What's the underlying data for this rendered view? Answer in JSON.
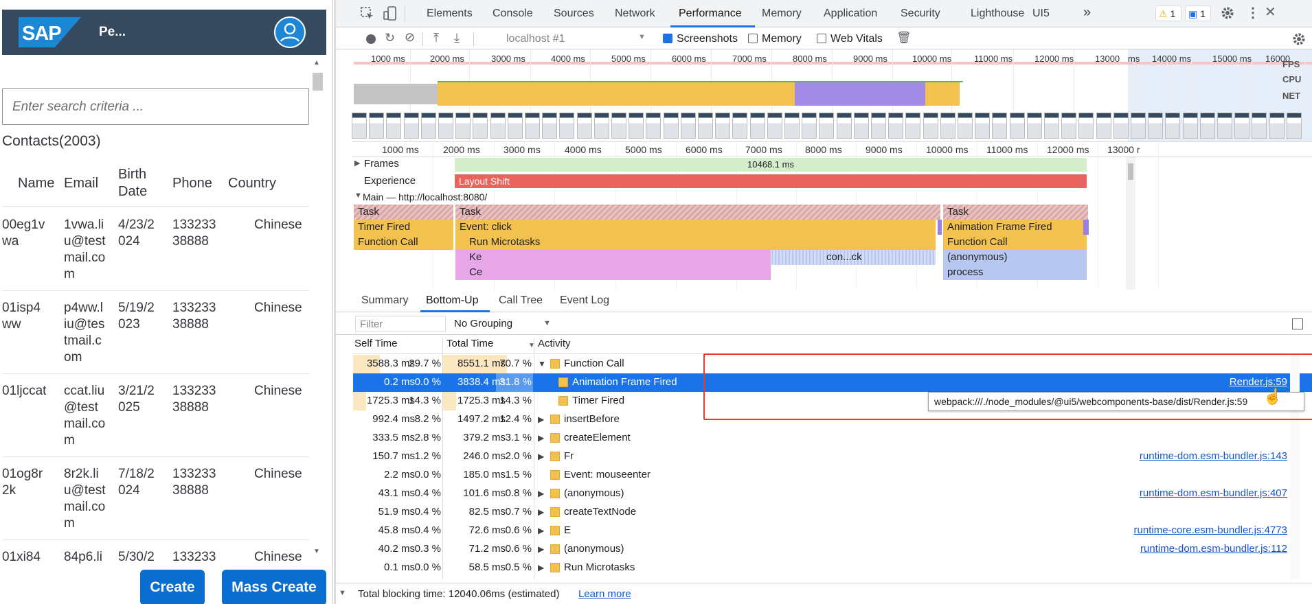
{
  "app": {
    "logo": "SAP",
    "title": "Pe...",
    "search_placeholder": "Enter search criteria ...",
    "section_title": "Contacts(2003)",
    "columns": [
      "Name",
      "Email",
      "Birth Date",
      "Phone",
      "Country"
    ],
    "rows": [
      {
        "name": "00eg1v wa",
        "email": "1vwa.li u@test mail.co m",
        "birth": "4/23/2 024",
        "phone": "133233 38888",
        "country": "Chinese"
      },
      {
        "name": "01isp4 ww",
        "email": "p4ww.l iu@tes tmail.c om",
        "birth": "5/19/2 023",
        "phone": "133233 38888",
        "country": "Chinese"
      },
      {
        "name": "01ljccat",
        "email": "ccat.liu @test mail.co m",
        "birth": "3/21/2 025",
        "phone": "133233 38888",
        "country": "Chinese"
      },
      {
        "name": "01og8r 2k",
        "email": "8r2k.li u@test mail.co m",
        "birth": "7/18/2 024",
        "phone": "133233 38888",
        "country": "Chinese"
      },
      {
        "name": "01xi84",
        "email": "84p6.li",
        "birth": "5/30/2",
        "phone": "133233",
        "country": "Chinese"
      }
    ],
    "create_label": "Create",
    "mass_create_label": "Mass Create"
  },
  "devtools": {
    "tabs": [
      "Elements",
      "Console",
      "Sources",
      "Network",
      "Performance",
      "Memory",
      "Application",
      "Security",
      "Lighthouse",
      "UI5"
    ],
    "more": "»",
    "active_tab": "Performance",
    "warnings": "1",
    "messages": "1",
    "target": "localhost #1",
    "screenshots_label": "Screenshots",
    "memory_label": "Memory",
    "webvitals_label": "Web Vitals",
    "screenshots_checked": true,
    "memory_checked": false,
    "webvitals_checked": false,
    "overview_ticks": [
      "1000 ms",
      "2000 ms",
      "3000 ms",
      "4000 ms",
      "5000 ms",
      "6000 ms",
      "7000 ms",
      "8000 ms",
      "9000 ms",
      "10000 ms",
      "11000 ms",
      "12000 ms",
      "13000",
      "ms",
      "14000 ms",
      "15000 ms",
      "16000"
    ],
    "overview_labels": [
      "FPS",
      "CPU",
      "NET"
    ],
    "timeline_ticks": [
      "1000 ms",
      "2000 ms",
      "3000 ms",
      "4000 ms",
      "5000 ms",
      "6000 ms",
      "7000 ms",
      "8000 ms",
      "9000 ms",
      "10000 ms",
      "11000 ms",
      "12000 ms",
      "13000 r"
    ],
    "frames_label": "Frames",
    "frames_value": "10468.1 ms",
    "experience_label": "Experience",
    "layout_shift": "Layout Shift",
    "main_label": "Main — http://localhost:8080/",
    "flame": {
      "task": "Task",
      "timer_fired": "Timer Fired",
      "event_click": "Event: click",
      "function_call": "Function Call",
      "run_microtasks": "Run Microtasks",
      "ke": "Ke",
      "ce": "Ce",
      "conck": "con...ck",
      "animation_frame_fired": "Animation Frame Fired",
      "anonymous": "(anonymous)",
      "process": "process"
    },
    "bottom_tabs": [
      "Summary",
      "Bottom-Up",
      "Call Tree",
      "Event Log"
    ],
    "active_bottom_tab": "Bottom-Up",
    "filter_placeholder": "Filter",
    "grouping": "No Grouping",
    "headers": {
      "self": "Self Time",
      "total": "Total Time",
      "activity": "Activity"
    },
    "rows": [
      {
        "self": "3588.3 ms",
        "self_pct": "29.7 %",
        "total": "8551.1 ms",
        "total_pct": "70.7 %",
        "activity": "Function Call",
        "expanded": true,
        "indent": 0,
        "link": "",
        "self_fill": 29.7,
        "total_fill": 70.7
      },
      {
        "self": "0.2 ms",
        "self_pct": "0.0 %",
        "total": "3838.4 ms",
        "total_pct": "31.8 %",
        "activity": "Animation Frame Fired",
        "expanded": false,
        "indent": 1,
        "link": "Render.js:59",
        "self_fill": 0,
        "total_fill": 31.8,
        "selected": true
      },
      {
        "self": "1725.3 ms",
        "self_pct": "14.3 %",
        "total": "1725.3 ms",
        "total_pct": "14.3 %",
        "activity": "Timer Fired",
        "expanded": false,
        "indent": 1,
        "link": "",
        "self_fill": 14.3,
        "total_fill": 14.3
      },
      {
        "self": "992.4 ms",
        "self_pct": "8.2 %",
        "total": "1497.2 ms",
        "total_pct": "12.4 %",
        "activity": "insertBefore",
        "expanded": false,
        "indent": 0,
        "link": "",
        "self_fill": 8.2,
        "total_fill": 12.4
      },
      {
        "self": "333.5 ms",
        "self_pct": "2.8 %",
        "total": "379.2 ms",
        "total_pct": "3.1 %",
        "activity": "createElement",
        "expanded": false,
        "indent": 0,
        "link": "",
        "self_fill": 2.8,
        "total_fill": 3.1
      },
      {
        "self": "150.7 ms",
        "self_pct": "1.2 %",
        "total": "246.0 ms",
        "total_pct": "2.0 %",
        "activity": "Fr",
        "expanded": false,
        "indent": 0,
        "link": "runtime-dom.esm-bundler.js:143",
        "self_fill": 1.2,
        "total_fill": 2.0
      },
      {
        "self": "2.2 ms",
        "self_pct": "0.0 %",
        "total": "185.0 ms",
        "total_pct": "1.5 %",
        "activity": "Event: mouseenter",
        "expanded": false,
        "indent": 0,
        "link": "",
        "self_fill": 0,
        "total_fill": 1.5,
        "noarrow": true
      },
      {
        "self": "43.1 ms",
        "self_pct": "0.4 %",
        "total": "101.6 ms",
        "total_pct": "0.8 %",
        "activity": "(anonymous)",
        "expanded": false,
        "indent": 0,
        "link": "runtime-dom.esm-bundler.js:407",
        "self_fill": 0.4,
        "total_fill": 0.8
      },
      {
        "self": "51.9 ms",
        "self_pct": "0.4 %",
        "total": "82.5 ms",
        "total_pct": "0.7 %",
        "activity": "createTextNode",
        "expanded": false,
        "indent": 0,
        "link": "",
        "self_fill": 0.4,
        "total_fill": 0.7
      },
      {
        "self": "45.8 ms",
        "self_pct": "0.4 %",
        "total": "72.6 ms",
        "total_pct": "0.6 %",
        "activity": "E",
        "expanded": false,
        "indent": 0,
        "link": "runtime-core.esm-bundler.js:4773",
        "self_fill": 0.4,
        "total_fill": 0.6
      },
      {
        "self": "40.2 ms",
        "self_pct": "0.3 %",
        "total": "71.2 ms",
        "total_pct": "0.6 %",
        "activity": "(anonymous)",
        "expanded": false,
        "indent": 0,
        "link": "runtime-dom.esm-bundler.js:112",
        "self_fill": 0.3,
        "total_fill": 0.6
      },
      {
        "self": "0.1 ms",
        "self_pct": "0.0 %",
        "total": "58.5 ms",
        "total_pct": "0.5 %",
        "activity": "Run Microtasks",
        "expanded": false,
        "indent": 0,
        "link": "",
        "self_fill": 0,
        "total_fill": 0.5
      }
    ],
    "tooltip": "webpack:///./node_modules/@ui5/webcomponents-base/dist/Render.js:59",
    "status_text": "Total blocking time: 12040.06ms (estimated)",
    "learn_more": "Learn more",
    "colors": {
      "accent": "#1a73e8",
      "scripting": "#f2c14e",
      "rendering": "#9b7fe6",
      "highlight": "#e53935"
    }
  }
}
